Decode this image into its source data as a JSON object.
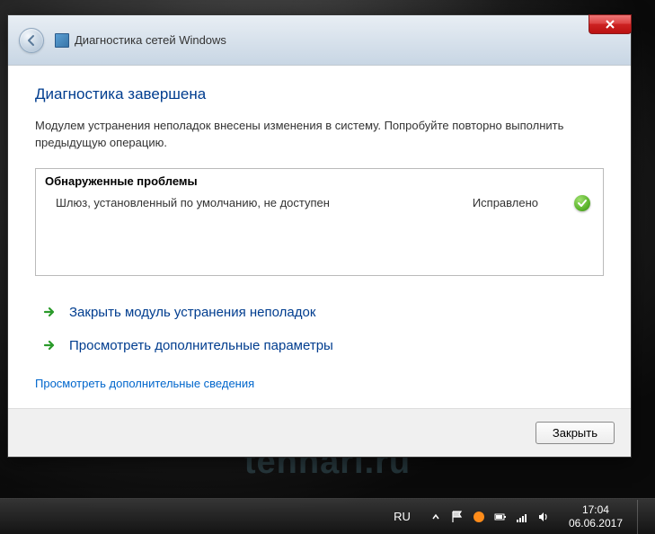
{
  "window": {
    "title": "Диагностика сетей Windows"
  },
  "content": {
    "heading": "Диагностика завершена",
    "description": "Модулем устранения неполадок внесены изменения в систему. Попробуйте повторно выполнить предыдущую операцию.",
    "problems_header": "Обнаруженные проблемы",
    "problems": [
      {
        "name": "Шлюз, установленный по умолчанию, не доступен",
        "status": "Исправлено"
      }
    ],
    "actions": {
      "close_troubleshooter": "Закрыть модуль устранения неполадок",
      "view_detailed": "Просмотреть дополнительные параметры"
    },
    "more_info_link": "Просмотреть дополнительные сведения",
    "close_button": "Закрыть"
  },
  "taskbar": {
    "language": "RU",
    "time": "17:04",
    "date": "06.06.2017"
  },
  "watermark": "tehnari.ru"
}
